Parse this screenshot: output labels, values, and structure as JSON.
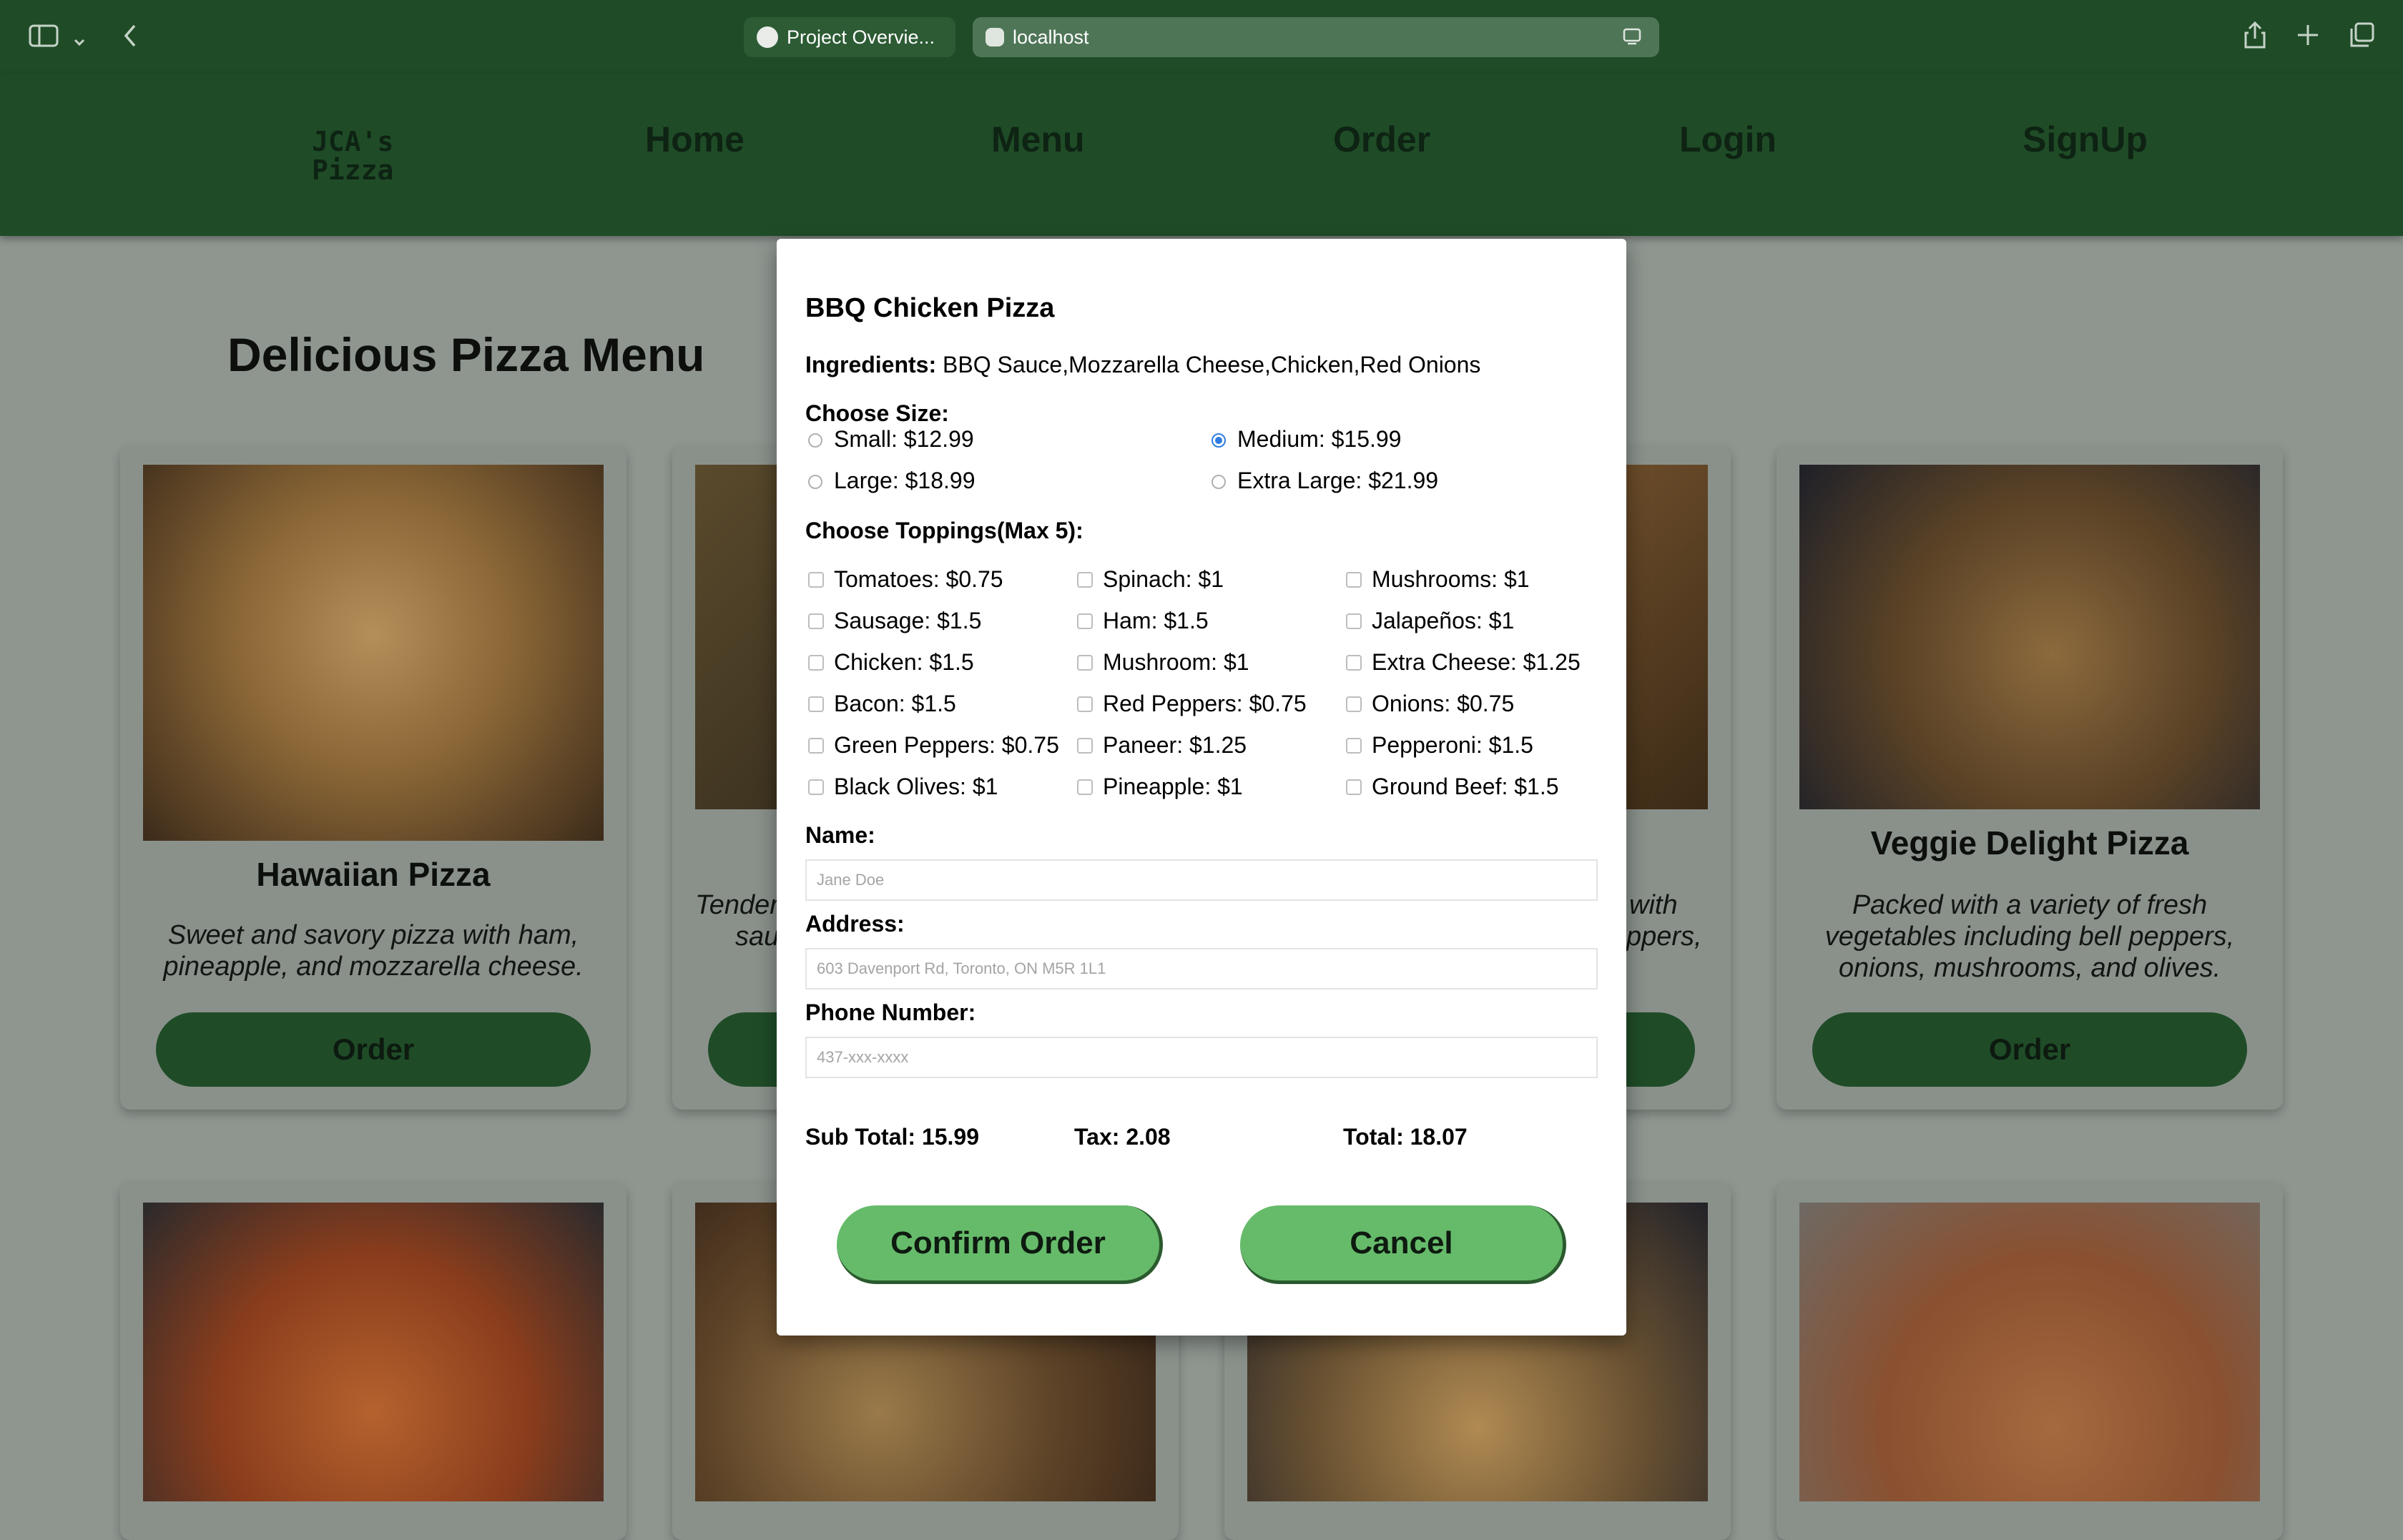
{
  "browser": {
    "tabs": [
      {
        "label": "Project Overvie..."
      },
      {
        "label": "localhost"
      }
    ]
  },
  "nav": {
    "logo_line1": "JCA's",
    "logo_line2": "Pizza",
    "items": [
      "Home",
      "Menu",
      "Order",
      "Login",
      "SignUp"
    ]
  },
  "page": {
    "title": "Delicious Pizza Menu",
    "cards": [
      {
        "title": "Hawaiian Pizza",
        "desc_line1": "Sweet and savory pizza with ham,",
        "desc_line2": "pineapple, and mozzarella cheese.",
        "button": "Order"
      },
      {
        "title": "",
        "desc_line1": "Tender",
        "desc_line2": "sau",
        "button": "Order"
      },
      {
        "title": "",
        "desc_line1": "with",
        "desc_line2": "ppers,",
        "button": "Order"
      },
      {
        "title": "Veggie Delight Pizza",
        "desc_line1": "Packed with a variety of fresh",
        "desc_line2": "vegetables including bell peppers,",
        "desc_line3": "onions, mushrooms, and olives.",
        "button": "Order"
      }
    ]
  },
  "modal": {
    "title": "BBQ Chicken Pizza",
    "ingredients_label": "Ingredients:",
    "ingredients": "BBQ Sauce,Mozzarella Cheese,Chicken,Red Onions",
    "size_label": "Choose Size:",
    "sizes": [
      {
        "label": "Small: $12.99",
        "selected": false
      },
      {
        "label": "Medium: $15.99",
        "selected": true
      },
      {
        "label": "Large: $18.99",
        "selected": false
      },
      {
        "label": "Extra Large: $21.99",
        "selected": false
      }
    ],
    "toppings_label": "Choose Toppings(Max 5):",
    "toppings": [
      "Tomatoes: $0.75",
      "Spinach: $1",
      "Mushrooms: $1",
      "Sausage: $1.5",
      "Ham: $1.5",
      "Jalapeños: $1",
      "Chicken: $1.5",
      "Mushroom: $1",
      "Extra Cheese: $1.25",
      "Bacon: $1.5",
      "Red Peppers: $0.75",
      "Onions: $0.75",
      "Green Peppers: $0.75",
      "Paneer: $1.25",
      "Pepperoni: $1.5",
      "Black Olives: $1",
      "Pineapple: $1",
      "Ground Beef: $1.5"
    ],
    "name_label": "Name:",
    "name_placeholder": "Jane Doe",
    "address_label": "Address:",
    "address_placeholder": "603 Davenport Rd, Toronto, ON M5R 1L1",
    "phone_label": "Phone Number:",
    "phone_placeholder": "437-xxx-xxxx",
    "subtotal": "Sub Total: 15.99",
    "tax": "Tax: 2.08",
    "total": "Total: 18.07",
    "confirm_button": "Confirm Order",
    "cancel_button": "Cancel"
  },
  "colors": {
    "nav_green": "#1f4c27",
    "button_green": "#66bb6a",
    "radio_accent": "#2f7de1"
  }
}
